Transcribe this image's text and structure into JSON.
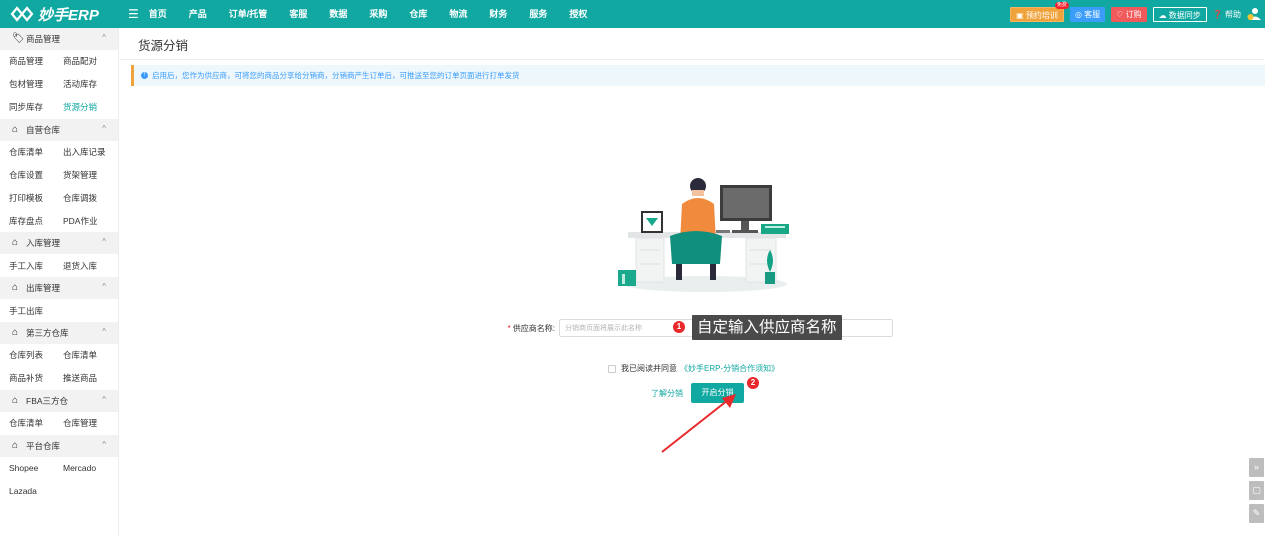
{
  "app": {
    "logo_text": "妙手ERP"
  },
  "nav": {
    "items": [
      "首页",
      "产品",
      "订单/托管",
      "客服",
      "数据",
      "采购",
      "仓库",
      "物流",
      "财务",
      "服务",
      "授权"
    ]
  },
  "toolbar": {
    "training_label": "预约培训",
    "training_badge": "免费",
    "service_label": "客服",
    "order_label": "订购",
    "sync_label": "数据同步",
    "help_label": "帮助"
  },
  "sidebar": {
    "groups": [
      {
        "title": "商品管理",
        "icon": "tag-icon",
        "items": [
          "商品管理",
          "商品配对",
          "包材管理",
          "活动库存",
          "同步库存",
          "货源分销"
        ],
        "active": "货源分销"
      },
      {
        "title": "自营仓库",
        "icon": "warehouse-icon",
        "items": [
          "仓库清单",
          "出入库记录",
          "仓库设置",
          "货架管理",
          "打印模板",
          "仓库调拨",
          "库存盘点",
          "PDA作业"
        ]
      },
      {
        "title": "入库管理",
        "icon": "warehouse-icon",
        "items": [
          "手工入库",
          "退货入库"
        ]
      },
      {
        "title": "出库管理",
        "icon": "warehouse-icon",
        "items": [
          "手工出库"
        ]
      },
      {
        "title": "第三方仓库",
        "icon": "warehouse-icon",
        "items": [
          "仓库列表",
          "仓库清单",
          "商品补货",
          "推送商品"
        ]
      },
      {
        "title": "FBA三方仓",
        "icon": "warehouse-icon",
        "items": [
          "仓库清单",
          "仓库管理"
        ]
      },
      {
        "title": "平台仓库",
        "icon": "warehouse-icon",
        "items": [
          "Shopee",
          "Mercado",
          "Lazada"
        ]
      }
    ]
  },
  "page": {
    "title": "货源分销",
    "notice": "启用后，您作为供应商，可将您的商品分享给分销商，分销商产生订单后，可推送至您的订单页面进行打单发货",
    "supplier_label": "供应商名称:",
    "supplier_required_mark": "*",
    "supplier_placeholder": "分销商页面将展示此名称",
    "agree_text": "我已阅读并同意",
    "agree_link": "《妙手ERP-分销合作须知》",
    "learn_link": "了解分销",
    "start_button": "开启分销"
  },
  "annotations": {
    "badge_1": "1",
    "label_1": "自定输入供应商名称",
    "badge_2": "2"
  },
  "colors": {
    "brand": "#11a8a2",
    "notice_bg": "#eef7fc",
    "notice_accent": "#f0a33b",
    "annotation_red": "#e8282b"
  }
}
